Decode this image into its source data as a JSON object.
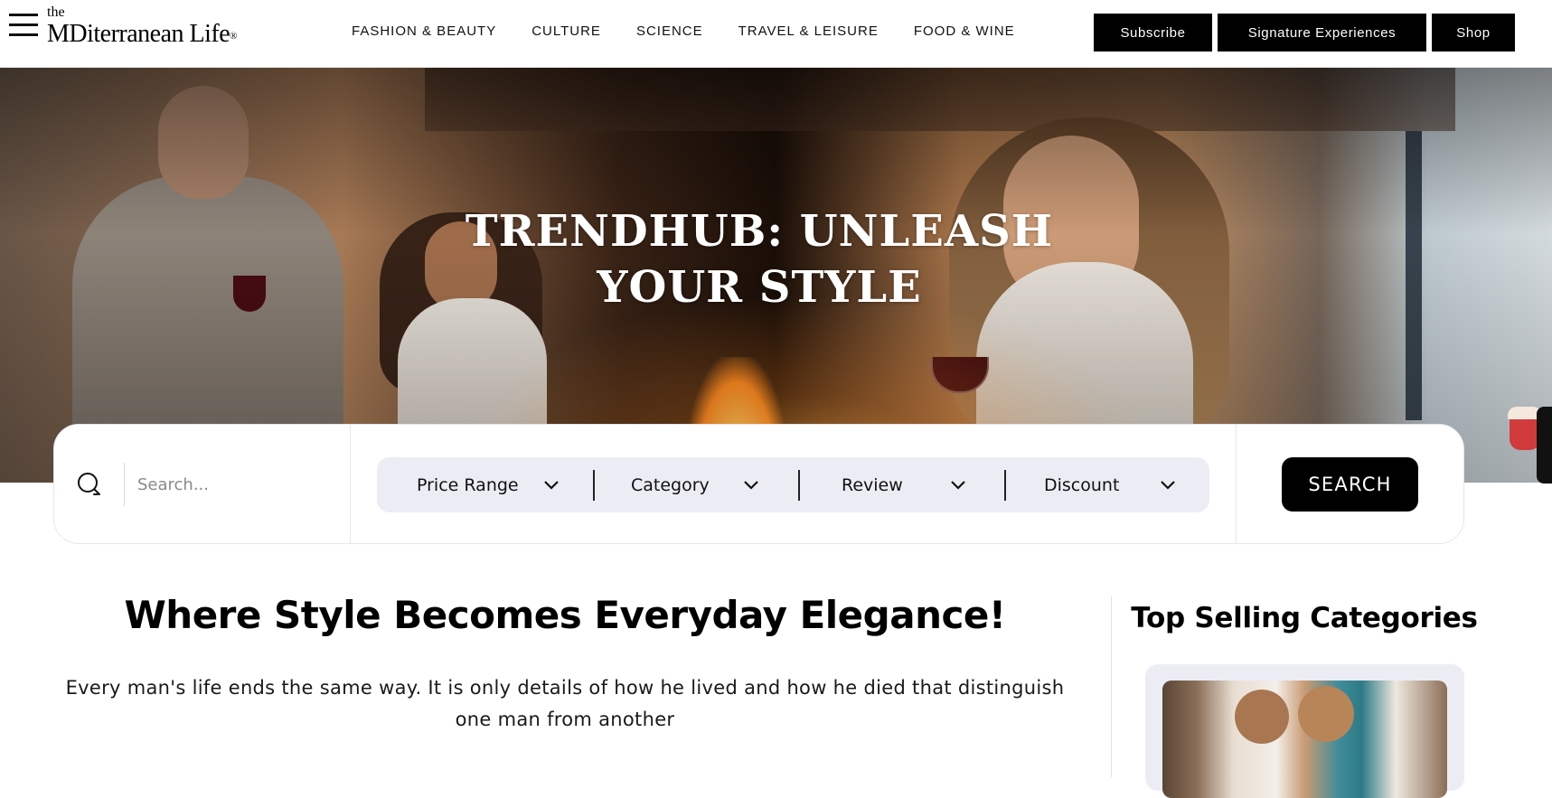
{
  "header": {
    "logo": {
      "small": "the",
      "main": "MDiterranean Life",
      "reg": "®"
    },
    "nav": [
      "FASHION & BEAUTY",
      "CULTURE",
      "SCIENCE",
      "TRAVEL & LEISURE",
      "FOOD & WINE"
    ],
    "buttons": {
      "subscribe": "Subscribe",
      "signature": "Signature Experiences",
      "shop": "Shop"
    },
    "icons": {
      "menu": "hamburger-menu-icon"
    }
  },
  "hero": {
    "title_line1": "TRENDHUB: UNLEASH",
    "title_line2": "YOUR STYLE"
  },
  "search": {
    "placeholder": "Search...",
    "value": "",
    "filters": [
      "Price Range",
      "Category",
      "Review",
      "Discount"
    ],
    "button": "SEARCH",
    "icons": {
      "search": "search-icon",
      "dropdown": "chevron-down-icon"
    }
  },
  "main": {
    "headline": "Where Style Becomes Everyday Elegance!",
    "subtext": "Every man's life ends the same way. It is only details of how he lived and how he died that distinguish one man from another"
  },
  "sidebar": {
    "heading": "Top Selling Categories"
  },
  "colors": {
    "accent": "#000000",
    "filter_bg": "#ecedf4",
    "page_bg": "#ffffff"
  }
}
